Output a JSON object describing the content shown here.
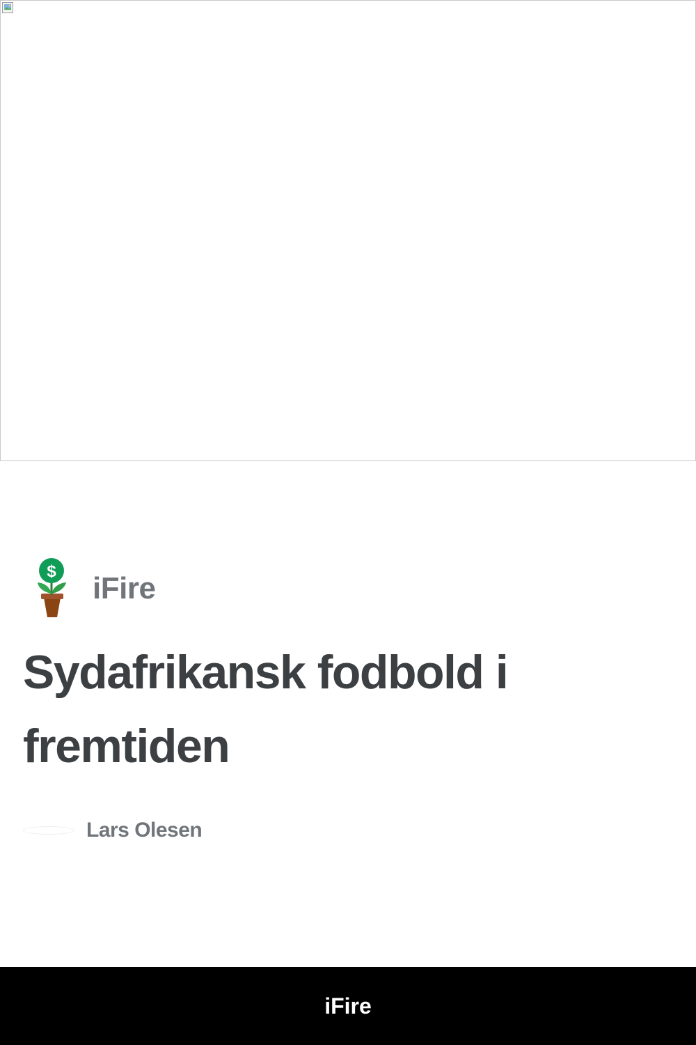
{
  "hero": {
    "alt": "",
    "icon": "broken-image-icon"
  },
  "brand": {
    "logo_icon": "money-plant-icon",
    "name": "iFire",
    "colors": {
      "coin": "#0f9d58",
      "leaf": "#34a853",
      "pot": "#a0522d"
    }
  },
  "article": {
    "title": "Sydafrikansk fodbold i fremtiden",
    "author": "Lars Olesen"
  },
  "footer": {
    "label": "iFire",
    "background": "#000000"
  }
}
